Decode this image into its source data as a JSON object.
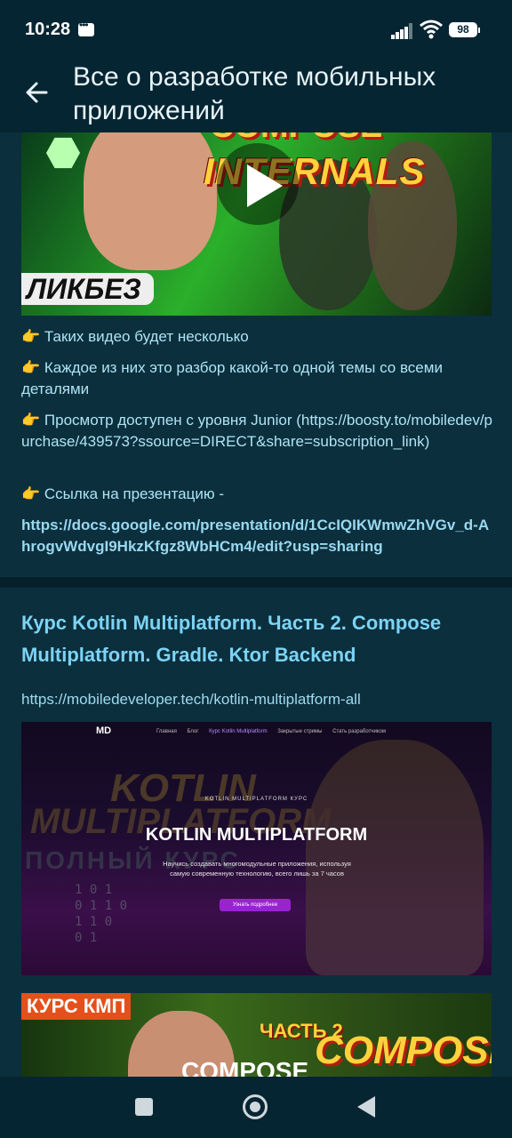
{
  "status_bar": {
    "time": "10:28",
    "battery": "98",
    "icons": [
      "message-icon",
      "signal-icon",
      "wifi-icon",
      "battery-icon"
    ]
  },
  "header": {
    "title": "Все о разработке мобильных приложений",
    "back_icon": "arrow-left-icon"
  },
  "post1": {
    "thumbnail": {
      "title_top": "COMPOSE",
      "title_main": "INTERNALS",
      "badge": "ЛИКБЕЗ"
    },
    "lines": [
      {
        "emoji": "👉",
        "text": "Таких видео будет несколько"
      },
      {
        "emoji": "👉",
        "text": "Каждое из них это разбор какой-то одной темы со всеми деталями"
      },
      {
        "emoji": "👉",
        "text": "Просмотр доступен с уровня Junior (https://boosty.to/mobiledev/purchase/439573?ssource=DIRECT&share=subscription_link)"
      },
      {
        "emoji": "👉",
        "text": "Ссылка на презентацию -"
      }
    ],
    "presentation_link": "https://docs.google.com/presentation/d/1CcIQIKWmwZhVGv_d-AhrogvWdvgI9HkzKfgz8WbHCm4/edit?usp=sharing"
  },
  "post2": {
    "title": "Курс Kotlin Multiplatform. Часть 2. Compose Multiplatform. Gradle. Ktor Backend",
    "url": "https://mobiledeveloper.tech/kotlin-multiplatform-all",
    "site_preview": {
      "logo": "MD",
      "nav": [
        "Главная",
        "Блог",
        "Курс Kotlin Multiplatform",
        "Закрытые стримы",
        "Стать разработчиком"
      ],
      "kicker": "KOTLIN MULTIPLATFORM КУРС",
      "headline": "KOTLIN MULTIPLATFORM",
      "description": "Научись создавать многомодульные приложения, используя самую современную технологию, всего лишь за 7 часов",
      "cta": "Узнать подробнее",
      "bg_text_1": "KOTLIN",
      "bg_text_2": "MULTIPLATFORM",
      "bg_text_3": "ПОЛНЫЙ КУРС"
    },
    "preview3": {
      "tag": "КУРС КМП",
      "part": "ЧАСТЬ 2",
      "compose_color": "COMPOSE",
      "compose_white": "COMPOSE"
    }
  },
  "colors": {
    "background": "#0b2f3d",
    "header": "#062532",
    "link": "#7cd3f4"
  }
}
